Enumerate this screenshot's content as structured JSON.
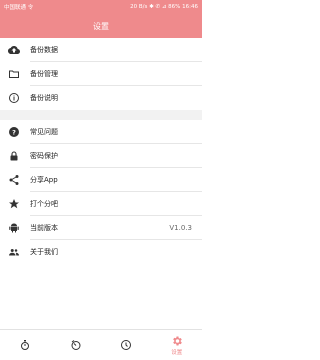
{
  "status_bar": {
    "carrier": "中国联通 令",
    "right_text": "20 B/s ✱ ✆ ⊿ 86% 16:46"
  },
  "header": {
    "title": "设置"
  },
  "menu": {
    "group1": [
      {
        "label": "备份数据",
        "icon": "cloud-upload-icon"
      },
      {
        "label": "备份管理",
        "icon": "folder-icon"
      },
      {
        "label": "备份说明",
        "icon": "info-icon"
      }
    ],
    "group2": [
      {
        "label": "常见问题",
        "icon": "help-icon"
      },
      {
        "label": "密码保护",
        "icon": "lock-icon"
      },
      {
        "label": "分享App",
        "icon": "share-icon"
      },
      {
        "label": "打个分吧",
        "icon": "star-icon"
      },
      {
        "label": "当前版本",
        "icon": "android-icon",
        "value": "V1.0.3"
      },
      {
        "label": "关于我们",
        "icon": "people-icon"
      }
    ]
  },
  "tabbar": {
    "tabs": [
      {
        "icon": "stopwatch-icon",
        "label": ""
      },
      {
        "icon": "timer-icon",
        "label": ""
      },
      {
        "icon": "clock-icon",
        "label": ""
      },
      {
        "icon": "gear-icon",
        "label": "设置",
        "active": true
      }
    ]
  },
  "colors": {
    "accent": "#ef8a8c",
    "icon": "#333333"
  }
}
